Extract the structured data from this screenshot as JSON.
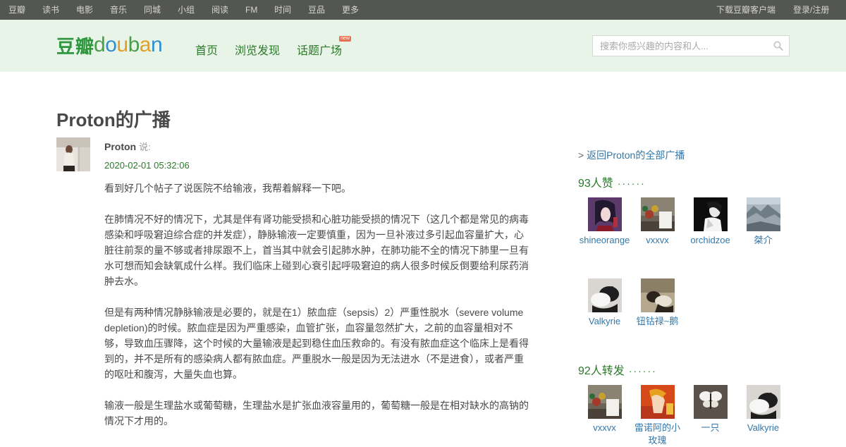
{
  "global_nav": {
    "left": [
      "豆瓣",
      "读书",
      "电影",
      "音乐",
      "同城",
      "小组",
      "阅读",
      "FM",
      "时间",
      "豆品",
      "更多"
    ],
    "download": "下载豆瓣客户端",
    "login": "登录/注册"
  },
  "header": {
    "logo_cn": "豆瓣",
    "logo_en_letters": [
      "d",
      "o",
      "u",
      "b",
      "a",
      "n"
    ],
    "nav": [
      "首页",
      "浏览发现",
      "话题广场"
    ],
    "new_badge": "new",
    "search_placeholder": "搜索你感兴趣的内容和人..."
  },
  "colors": {
    "global_nav_bg": "#545652",
    "header_bg": "#e9f4e9",
    "brand_green": "#2e963d",
    "link_blue": "#3377aa",
    "green_text": "#2a7a2a"
  },
  "main": {
    "title": "Proton的广播",
    "author": "Proton",
    "said": "说:",
    "timestamp": "2020-02-01 05:32:06",
    "paragraphs": [
      "看到好几个帖子了说医院不给输液，我帮着解释一下吧。",
      "在肺情况不好的情况下，尤其是伴有肾功能受损和心脏功能受损的情况下（这几个都是常见的病毒感染和呼吸窘迫综合症的并发症），静脉输液一定要慎重，因为一旦补液过多引起血容量扩大，心脏往前泵的量不够或者排尿跟不上，首当其中就会引起肺水肿，在肺功能不全的情况下肺里一旦有水可想而知会缺氧成什么样。我们临床上碰到心衰引起呼吸窘迫的病人很多时候反倒要给利尿药消肿去水。",
      "但是有两种情况静脉输液是必要的，就是在1）脓血症（sepsis）2）严重性脱水（severe volume depletion)的时候。脓血症是因为严重感染，血管扩张，血容量忽然扩大，之前的血容量相对不够，导致血压骤降，这个时候的大量输液是起到稳住血压救命的。有没有脓血症这个临床上是看得到的，并不是所有的感染病人都有脓血症。严重脱水一般是因为无法进水（不是进食），或者严重的呕吐和腹泻，大量失血也算。",
      "输液一般是生理盐水或葡萄糖，生理盐水是扩张血液容量用的，葡萄糖一般是在相对缺水的高钠的情况下才用的。"
    ]
  },
  "sidebar": {
    "back_prefix": ">",
    "back_link": "返回Proton的全部广播",
    "likes_title": "93人赞",
    "likes_dots": "······",
    "likes": [
      {
        "name": "shineorange",
        "icon": "anime-portrait-avatar"
      },
      {
        "name": "vxxvx",
        "icon": "still-life-avatar"
      },
      {
        "name": "orchidzoe",
        "icon": "bw-portrait-avatar"
      },
      {
        "name": "桀介",
        "icon": "landscape-avatar"
      },
      {
        "name": "Valkyrie",
        "icon": "cats-avatar"
      },
      {
        "name": "钮钴禄~鹅",
        "icon": "cats-sepia-avatar"
      }
    ],
    "reshares_title": "92人转发",
    "reshares_dots": "······",
    "reshares": [
      {
        "name": "vxxvx",
        "icon": "still-life-avatar"
      },
      {
        "name": "雷诺阿的小玫瑰",
        "icon": "painting-avatar"
      },
      {
        "name": "一只",
        "icon": "butterfly-avatar"
      },
      {
        "name": "Valkyrie",
        "icon": "cats-avatar"
      }
    ]
  }
}
